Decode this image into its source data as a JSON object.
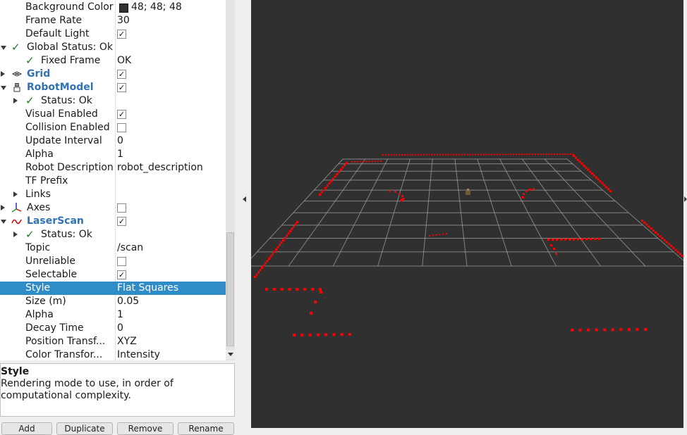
{
  "displays": {
    "rows": [
      {
        "name": "Background Color",
        "value": "48; 48; 48",
        "swatch": "#303030"
      },
      {
        "name": "Frame Rate",
        "value": "30"
      },
      {
        "name": "Default Light",
        "checked": true
      },
      {
        "name": "Global Status: Ok",
        "status": true,
        "expanded": true
      },
      {
        "name": "Fixed Frame",
        "value": "OK",
        "status": true
      },
      {
        "name": "Grid",
        "checked": true,
        "display": true,
        "icon": "grid-icon"
      },
      {
        "name": "RobotModel",
        "checked": true,
        "display": true,
        "expanded": true,
        "icon": "robot-model-icon"
      },
      {
        "name": "Status: Ok",
        "status": true
      },
      {
        "name": "Visual Enabled",
        "checked": true
      },
      {
        "name": "Collision Enabled",
        "checked": false
      },
      {
        "name": "Update Interval",
        "value": "0"
      },
      {
        "name": "Alpha",
        "value": "1"
      },
      {
        "name": "Robot Description",
        "value": "robot_description"
      },
      {
        "name": "TF Prefix",
        "value": ""
      },
      {
        "name": "Links"
      },
      {
        "name": "Axes",
        "checked": false,
        "icon": "axes-icon"
      },
      {
        "name": "LaserScan",
        "checked": true,
        "display": true,
        "expanded": true,
        "icon": "laser-scan-icon"
      },
      {
        "name": "Status: Ok",
        "status": true
      },
      {
        "name": "Topic",
        "value": "/scan"
      },
      {
        "name": "Unreliable",
        "checked": false
      },
      {
        "name": "Selectable",
        "checked": true
      },
      {
        "name": "Style",
        "value": "Flat Squares",
        "selected": true
      },
      {
        "name": "Size (m)",
        "value": "0.05"
      },
      {
        "name": "Alpha",
        "value": "1"
      },
      {
        "name": "Decay Time",
        "value": "0"
      },
      {
        "name": "Position Transf...",
        "value": "XYZ"
      },
      {
        "name": "Color Transfor...",
        "value": "Intensity"
      }
    ]
  },
  "description": {
    "title": "Style",
    "text": "Rendering mode to use, in order of computational complexity."
  },
  "buttons": [
    {
      "label": "Add"
    },
    {
      "label": "Duplicate"
    },
    {
      "label": "Remove"
    },
    {
      "label": "Rename"
    }
  ],
  "colors": {
    "selection": "#308cc6",
    "display_name": "#2f72b5",
    "status_ok": "#1f7a1f",
    "viewport_background": "#303030",
    "grid_lines": "#a0a0a0",
    "laser_points": "#ff0000"
  }
}
